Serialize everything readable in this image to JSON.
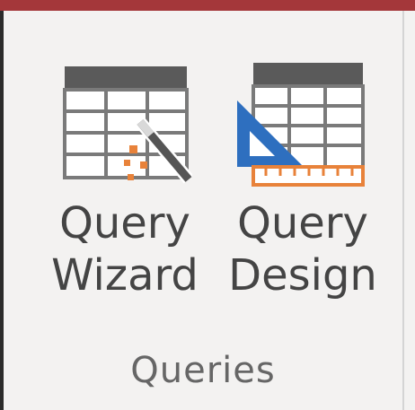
{
  "ribbon": {
    "group": {
      "label": "Queries",
      "buttons": [
        {
          "line1": "Query",
          "line2": "Wizard",
          "icon": "query-wizard-icon"
        },
        {
          "line1": "Query",
          "line2": "Design",
          "icon": "query-design-icon"
        }
      ]
    }
  },
  "colors": {
    "header": "#a4373a",
    "table_header": "#5a5a5a",
    "table_grid": "#7a7a7a",
    "triangle": "#2e6fbf",
    "ruler": "#e8823a",
    "text": "#444444"
  }
}
